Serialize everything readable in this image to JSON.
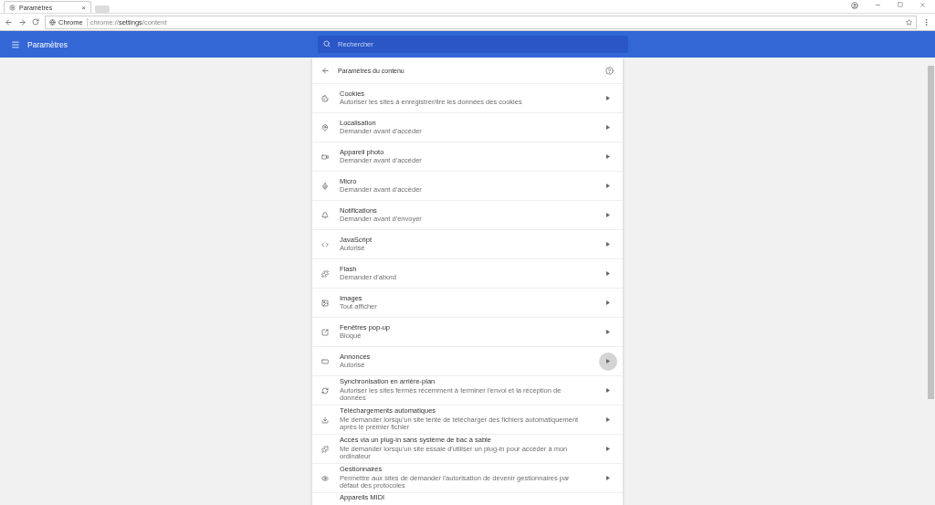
{
  "browser": {
    "tab": {
      "title": "Paramètres",
      "close": "×",
      "selected": true
    },
    "site_label": "Chrome",
    "url_prefix": "chrome://",
    "url_bold": "settings",
    "url_suffix": "/content"
  },
  "header": {
    "title": "Paramètres",
    "search": {
      "placeholder": "Rechercher"
    }
  },
  "panel": {
    "title": "Paramètres du contenu",
    "items": [
      {
        "kind": "cookie",
        "title": "Cookies",
        "subtitle": "Autoriser les sites à enregistrer/lire les données des cookies",
        "hovered": false
      },
      {
        "kind": "location",
        "title": "Localisation",
        "subtitle": "Demander avant d'accéder",
        "hovered": false
      },
      {
        "kind": "camera",
        "title": "Appareil photo",
        "subtitle": "Demander avant d'accéder",
        "hovered": false
      },
      {
        "kind": "mic",
        "title": "Micro",
        "subtitle": "Demander avant d'accéder",
        "hovered": false
      },
      {
        "kind": "bell",
        "title": "Notifications",
        "subtitle": "Demander avant d'envoyer",
        "hovered": false
      },
      {
        "kind": "code",
        "title": "JavaScript",
        "subtitle": "Autorisé",
        "hovered": false
      },
      {
        "kind": "puzzle",
        "title": "Flash",
        "subtitle": "Demander d'abord",
        "hovered": false
      },
      {
        "kind": "image",
        "title": "Images",
        "subtitle": "Tout afficher",
        "hovered": false
      },
      {
        "kind": "popup",
        "title": "Fenêtres pop-up",
        "subtitle": "Bloqué",
        "hovered": false
      },
      {
        "kind": "ads",
        "title": "Annonces",
        "subtitle": "Autorisé",
        "hovered": true
      },
      {
        "kind": "sync",
        "title": "Synchronisation en arrière-plan",
        "subtitle": "Autoriser les sites fermés récemment à terminer l'envoi et la réception de données",
        "hovered": false
      },
      {
        "kind": "download",
        "title": "Téléchargements automatiques",
        "subtitle": "Me demander lorsqu'un site tente de télécharger des fichiers automatiquement après le premier fichier",
        "hovered": false
      },
      {
        "kind": "puzzle",
        "title": "Accès via un plug-in sans système de bac à sable",
        "subtitle": "Me demander lorsqu'un site essaie d'utiliser un plug-in pour accéder à mon ordinateur",
        "hovered": false
      },
      {
        "kind": "eye",
        "title": "Gestionnaires",
        "subtitle": "Permettre aux sites de demander l'autorisation de devenir gestionnaires par défaut des protocoles",
        "hovered": false
      },
      {
        "kind": "partial",
        "title": "Appareils MIDI"
      }
    ]
  }
}
